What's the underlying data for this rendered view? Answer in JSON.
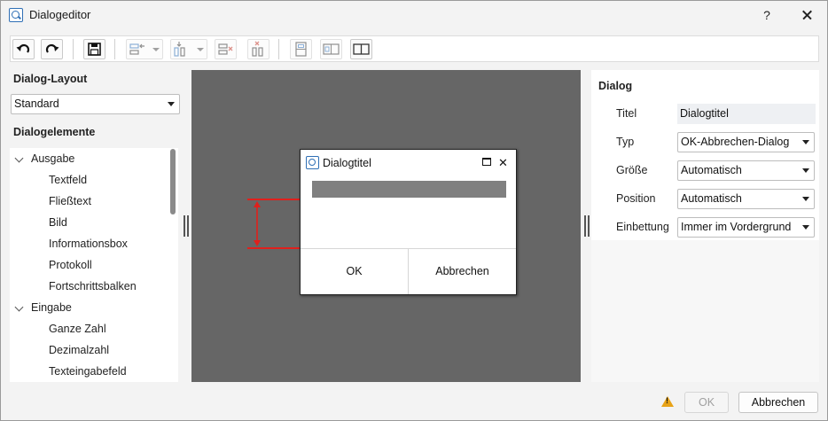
{
  "window": {
    "title": "Dialogeditor",
    "help_label": "?"
  },
  "toolbar": {
    "buttons": [
      "undo-icon",
      "redo-icon",
      "save-icon",
      "align-left-icon",
      "distribute-vertical-icon",
      "remove-row-icon",
      "remove-column-icon",
      "split-vertical-icon",
      "split-horizontal-icon",
      "columns-icon"
    ]
  },
  "left": {
    "layout_heading": "Dialog-Layout",
    "layout_value": "Standard",
    "elements_heading": "Dialogelemente",
    "tree": [
      {
        "kind": "cat",
        "label": "Ausgabe"
      },
      {
        "kind": "item",
        "label": "Textfeld"
      },
      {
        "kind": "item",
        "label": "Fließtext"
      },
      {
        "kind": "item",
        "label": "Bild"
      },
      {
        "kind": "item",
        "label": "Informationsbox"
      },
      {
        "kind": "item",
        "label": "Protokoll"
      },
      {
        "kind": "item",
        "label": "Fortschrittsbalken"
      },
      {
        "kind": "cat",
        "label": "Eingabe"
      },
      {
        "kind": "item",
        "label": "Ganze Zahl"
      },
      {
        "kind": "item",
        "label": "Dezimalzahl"
      },
      {
        "kind": "item",
        "label": "Texteingabefeld"
      }
    ]
  },
  "preview": {
    "title": "Dialogtitel",
    "ok_label": "OK",
    "cancel_label": "Abbrechen"
  },
  "props": {
    "heading": "Dialog",
    "rows": [
      {
        "label": "Titel",
        "value": "Dialogtitel",
        "dropdown": false
      },
      {
        "label": "Typ",
        "value": "OK-Abbrechen-Dialog",
        "dropdown": true
      },
      {
        "label": "Größe",
        "value": "Automatisch",
        "dropdown": true
      },
      {
        "label": "Position",
        "value": "Automatisch",
        "dropdown": true
      },
      {
        "label": "Einbettung",
        "value": "Immer im Vordergrund",
        "dropdown": true
      }
    ]
  },
  "footer": {
    "ok_label": "OK",
    "cancel_label": "Abbrechen"
  },
  "colors": {
    "accent": "#2f6fb5",
    "canvas": "#666666",
    "measure_line": "#e0201c",
    "warning": "#e8a317"
  }
}
